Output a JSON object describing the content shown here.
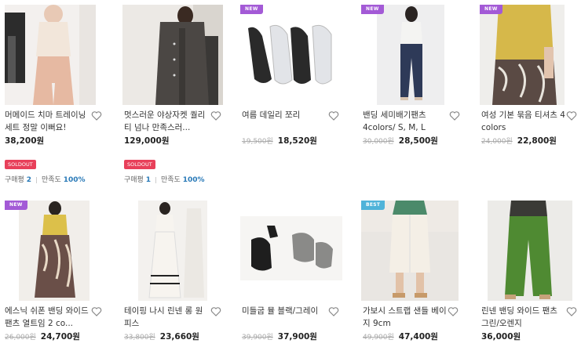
{
  "colors": {
    "new_badge": "#a35ad6",
    "best_badge": "#4fb3d9",
    "soldout": "#e8405a",
    "review_count": "#2a7ab8"
  },
  "products": [
    {
      "title": "머메이드 치마 트레이닝 세트 정말 이뻐요!",
      "price": "38,200원",
      "old_price": "",
      "badge": "",
      "soldout": "SOLDOUT",
      "purchase_label": "구매평",
      "purchase_count": "2",
      "satisfaction_label": "만족도",
      "satisfaction": "100%"
    },
    {
      "title": "멋스러운 야상자켓 퀄리티 넘나 만족스러...",
      "price": "129,000원",
      "old_price": "",
      "badge": "",
      "soldout": "SOLDOUT",
      "purchase_label": "구매평",
      "purchase_count": "1",
      "satisfaction_label": "만족도",
      "satisfaction": "100%"
    },
    {
      "title": "여름 데일리 쪼리",
      "price": "18,520원",
      "old_price": "19,500원",
      "badge": "NEW"
    },
    {
      "title": "밴딩 세미배기팬츠 4colors/ S, M, L",
      "price": "28,500원",
      "old_price": "30,000원",
      "badge": "NEW"
    },
    {
      "title": "여성 기본 묶음 티셔츠 4 colors",
      "price": "22,800원",
      "old_price": "24,000원",
      "badge": "NEW"
    },
    {
      "title": "에스닉 쉬폰 밴딩 와이드 팬츠 열트임 2 co...",
      "price": "24,700원",
      "old_price": "26,000원",
      "badge": "NEW"
    },
    {
      "title": "테이핑 나시 린넨 롱 원피스",
      "price": "23,660원",
      "old_price": "33,800원",
      "badge": ""
    },
    {
      "title": "미들굽 뮬 블랙/그레이",
      "price": "37,900원",
      "old_price": "39,900원",
      "badge": ""
    },
    {
      "title": "가보시 스트랩 샌들 베이지 9cm",
      "price": "47,400원",
      "old_price": "49,900원",
      "badge": "BEST"
    },
    {
      "title": "린넨 밴딩 와이드 팬츠 그린/오렌지",
      "price": "36,000원",
      "old_price": "",
      "badge": ""
    }
  ]
}
